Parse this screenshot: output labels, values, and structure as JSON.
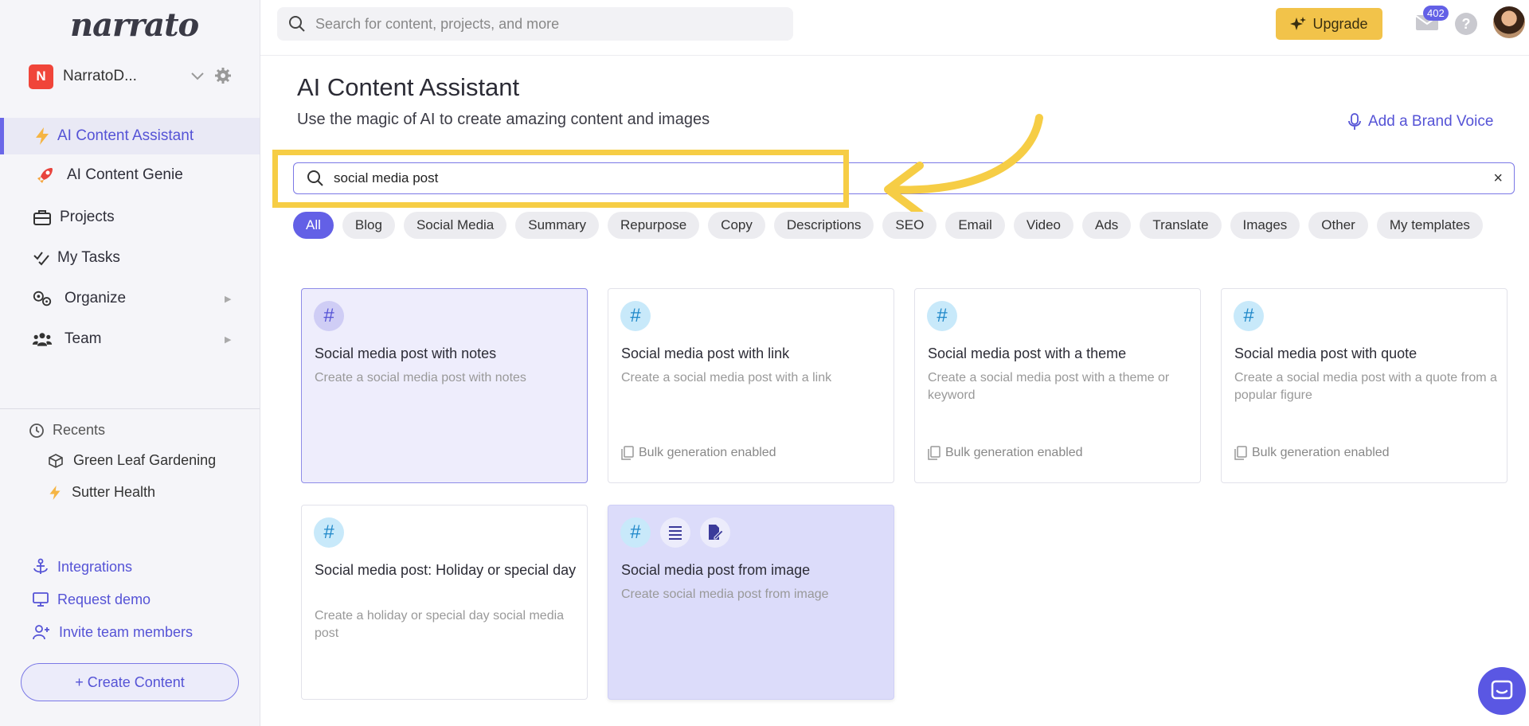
{
  "app": {
    "logo": "narrato"
  },
  "workspace": {
    "badge": "N",
    "name": "NarratoD..."
  },
  "sidebar": {
    "items": [
      {
        "label": "AI Content Assistant",
        "icon": "lightning-icon"
      },
      {
        "label": "AI Content Genie",
        "icon": "rocket-icon"
      },
      {
        "label": "Projects",
        "icon": "briefcase-icon"
      },
      {
        "label": "My Tasks",
        "icon": "tasks-check-icon"
      },
      {
        "label": "Organize",
        "icon": "gears-icon"
      },
      {
        "label": "Team",
        "icon": "team-icon"
      }
    ],
    "recents_label": "Recents",
    "recents": [
      {
        "label": "Green Leaf Gardening",
        "icon": "cube-icon"
      },
      {
        "label": "Sutter Health",
        "icon": "lightning-icon"
      }
    ],
    "links": [
      {
        "label": "Integrations",
        "icon": "anchor-icon"
      },
      {
        "label": "Request demo",
        "icon": "monitor-icon"
      },
      {
        "label": "Invite team members",
        "icon": "user-plus-icon"
      }
    ],
    "create_label": "+ Create Content"
  },
  "topbar": {
    "search_placeholder": "Search for content, projects, and more",
    "upgrade_label": "Upgrade",
    "mail_count": "402"
  },
  "main": {
    "title": "AI Content Assistant",
    "subtitle": "Use the magic of AI to create amazing content and images",
    "brand_voice_label": "Add a Brand Voice",
    "search_value": "social media post",
    "clear_label": "×",
    "chips": [
      "All",
      "Blog",
      "Social Media",
      "Summary",
      "Repurpose",
      "Copy",
      "Descriptions",
      "SEO",
      "Email",
      "Video",
      "Ads",
      "Translate",
      "Images",
      "Other",
      "My templates"
    ],
    "active_chip": "All",
    "cards": [
      {
        "title": "Social media post with notes",
        "desc": "Create a social media post with notes",
        "bulk": ""
      },
      {
        "title": "Social media post with link",
        "desc": "Create a social media post with a link",
        "bulk": "Bulk generation enabled"
      },
      {
        "title": "Social media post with a theme",
        "desc": "Create a social media post with a theme or keyword",
        "bulk": "Bulk generation enabled"
      },
      {
        "title": "Social media post with quote",
        "desc": "Create a social media post with a quote from a popular figure",
        "bulk": "Bulk generation enabled"
      },
      {
        "title": "Social media post: Holiday or special day",
        "desc": "Create a holiday or special day social media post",
        "bulk": ""
      },
      {
        "title": "Social media post from image",
        "desc": "Create social media post from image",
        "bulk": ""
      }
    ]
  },
  "colors": {
    "accent": "#6360e6",
    "upgrade": "#f2c34a",
    "highlight": "#f6cd45"
  }
}
